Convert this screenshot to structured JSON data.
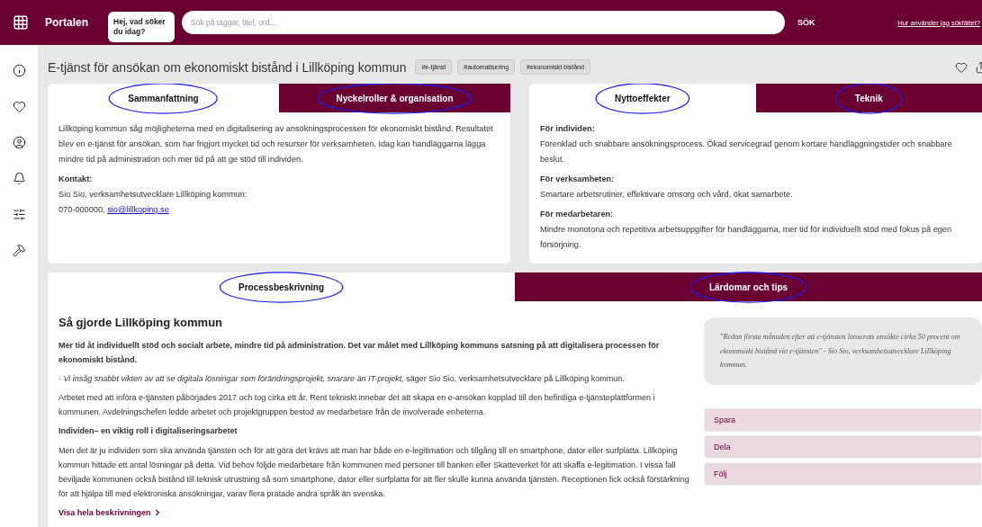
{
  "header": {
    "app_title": "Portalen",
    "greeting": "Hej, vad söker du idag?",
    "search_placeholder": "Sök på taggar, titel, ord...",
    "search_button": "SÖK",
    "help_link": "Hur använder jag sökfältet?"
  },
  "article": {
    "title": "E-tjänst för ansökan om ekonomiskt bistånd i Lillköping kommun",
    "tags": [
      "#e-tjänst",
      "#automatisering",
      "#ekonomiskt bistånd"
    ]
  },
  "summary_card": {
    "tabs": [
      {
        "label": "Sammanfattning",
        "selected": true,
        "annotated": true
      },
      {
        "label": "Nyckelroller & organisation",
        "selected": false,
        "annotated": true
      }
    ],
    "text": "Lillköping kommun såg möjligheterna med en digitalisering av ansökningsprocessen för ekonomiskt bistånd. Resultatet blev en e-tjänst för ansökan, som har frigjort mycket tid och resurser för verksamheten. Idag kan handläggarna lägga mindre tid på administration och mer tid på att ge stöd till individen.",
    "contact_label": "Kontakt:",
    "contact_person": "Sio Sio, verksamhetsutvecklare Lillköping kommun:",
    "contact_phone": "070-000000,",
    "contact_email": "sio@lillkoping.se"
  },
  "effects_card": {
    "tabs": [
      {
        "label": "Nyttoeffekter",
        "selected": true,
        "annotated": true
      },
      {
        "label": "Teknik",
        "selected": false,
        "annotated": true
      }
    ],
    "sections": [
      {
        "heading": "För individen:",
        "text": "Förenklad och snabbare ansökningsprocess. Ökad servicegrad genom kortare handläggningstider och snabbare beslut."
      },
      {
        "heading": "För verksamheten:",
        "text": "Smartare arbetsrutiner, effektivare omsorg och vård, ökat samarbete."
      },
      {
        "heading": "För medarbetaren:",
        "text": "Mindre monotona och repetitiva arbetsuppgifter för handläggarna, mer tid för individuellt stöd med fokus på egen försörjning."
      }
    ]
  },
  "process_card": {
    "tabs": [
      {
        "label": "Processbeskrivning",
        "selected": true,
        "annotated": true
      },
      {
        "label": "Lärdomar och tips",
        "selected": false,
        "annotated": true
      }
    ],
    "heading": "Så gjorde Lillköping kommun",
    "lead": "Mer tid åt individuellt stöd och socialt arbete, mindre tid på administration. Det var målet med Lillköping kommuns satsning på att digitalisera processen för ekonomiskt bistånd.",
    "quote_line": "*- Vi insåg snabbt vikten av att se digitala lösningar som förändringsprojekt, snarare än IT-projekt,* säger Sio Sio, verksamhetsutvecklare på Lillköping kommun.",
    "paragraph": "Arbetet med att införa e-tjänsten påbörjades 2017 och tog cirka ett år. Rent tekniskt innebar det att skapa en e-ansökan kopplad till den befintliga e-tjänsteplattformen i kommunen. Avdelningschefen ledde arbetet och projektgruppen bestod av medarbetare från de involverade enheterna.",
    "subheading": "Individen– en viktig roll i digitaliseringsarbetet",
    "paragraph_2": "Men det är ju individen som ska använda tjänsten och för att göra det krävs att man har både en e-legitimation och tillgång till en smartphone, dator eller surfplatta. Lillköping kommun hittade ett antal lösningar på detta. Vid behov följde medarbetare från kommunen med personer till banken eller Skatteverket för att skaffa e-legitimation. I vissa fall beviljade kommunen också bistånd till teknisk utrustning så som smartphone, dator eller surfplatta för att fler skulle kunna använda tjänsten. Receptionen fick också förstärkning för att hjälpa till med elektroniska ansökningar, varav flera pratade andra språk än svenska.",
    "more_link": "Visa hela beskrivningen",
    "pull_quote": "\"Redan första månaden efter att e-tjänsten lanserats ansökte cirka 50 procent om ekonomiskt bistånd via e-tjänsten\" - Sio Sio, verksamhetsutvecklare Lillköping kommun.",
    "actions": [
      "Spara",
      "Dela",
      "Följ"
    ]
  }
}
